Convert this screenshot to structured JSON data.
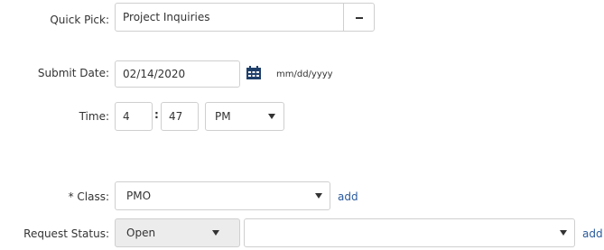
{
  "quick_pick": {
    "label": "Quick Pick:",
    "value": "Project Inquiries"
  },
  "submit_date": {
    "label": "Submit Date:",
    "value": "02/14/2020",
    "format_hint": "mm/dd/yyyy",
    "icon": "calendar-icon"
  },
  "time": {
    "label": "Time:",
    "hour": "4",
    "separator": ":",
    "minute": "47",
    "ampm": "PM"
  },
  "class_field": {
    "label": "* Class:",
    "value": "PMO",
    "add_label": "add"
  },
  "request_status": {
    "label": "Request Status:",
    "value": "Open",
    "second_value": "",
    "add_label": "add"
  },
  "colors": {
    "link": "#2a5a9c",
    "border": "#cfcfcf",
    "disabled_bg": "#ececec",
    "calendar_icon": "#1f3f6b"
  }
}
